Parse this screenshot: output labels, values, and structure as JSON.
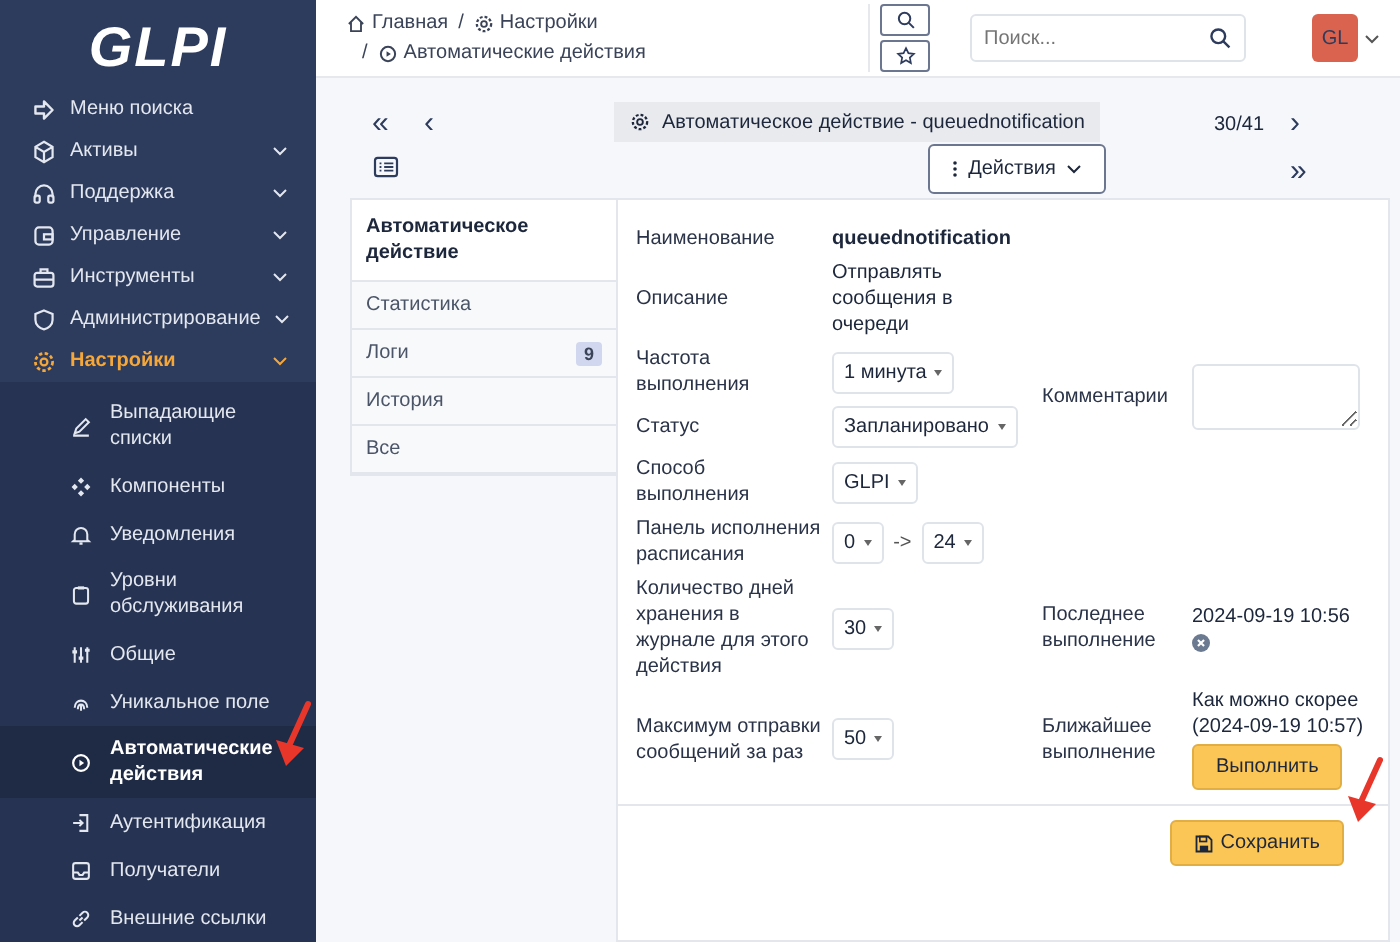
{
  "sidebar": {
    "logo": "GLPI",
    "items": [
      {
        "label": "Меню поиска",
        "has_caret": false,
        "selected": false
      },
      {
        "label": "Активы",
        "has_caret": true,
        "selected": false
      },
      {
        "label": "Поддержка",
        "has_caret": true,
        "selected": false
      },
      {
        "label": "Управление",
        "has_caret": true,
        "selected": false
      },
      {
        "label": "Инструменты",
        "has_caret": true,
        "selected": false
      },
      {
        "label": "Администрирование",
        "has_caret": true,
        "selected": false
      },
      {
        "label": "Настройки",
        "has_caret": true,
        "selected": true,
        "children": [
          {
            "label": "Выпадающие списки",
            "selected": false
          },
          {
            "label": "Компоненты",
            "selected": false
          },
          {
            "label": "Уведомления",
            "selected": false
          },
          {
            "label": "Уровни обслуживания",
            "selected": false
          },
          {
            "label": "Общие",
            "selected": false
          },
          {
            "label": "Уникальное поле",
            "selected": false
          },
          {
            "label": "Автоматические действия",
            "selected": true
          },
          {
            "label": "Аутентификация",
            "selected": false
          },
          {
            "label": "Получатели",
            "selected": false
          },
          {
            "label": "Внешние ссылки",
            "selected": false
          }
        ]
      }
    ]
  },
  "breadcrumb": {
    "separator": "/",
    "items": [
      "Главная",
      "Настройки",
      "Автоматические действия"
    ]
  },
  "search": {
    "placeholder": "Поиск..."
  },
  "user": {
    "initials": "GL",
    "color": "#d9634f"
  },
  "nav": {
    "first": "«",
    "previous": "‹",
    "title": "Автоматическое действие - queuednotification",
    "position": "30/41",
    "next": "›",
    "last": "»",
    "actions": "Действия"
  },
  "tabs": [
    {
      "label": "Автоматическое действие",
      "selected": true
    },
    {
      "label": "Статистика",
      "selected": false
    },
    {
      "label": "Логи",
      "badge": "9",
      "selected": false
    },
    {
      "label": "История",
      "selected": false
    },
    {
      "label": "Все",
      "selected": false
    }
  ],
  "form": {
    "name": {
      "label": "Наименование",
      "value": "queuednotification"
    },
    "description": {
      "label": "Описание",
      "value": "Отправлять сообщения в очереди"
    },
    "frequency": {
      "label": "Частота выполнения",
      "value": "1 минута"
    },
    "comments": {
      "label": "Комментарии"
    },
    "status": {
      "label": "Статус",
      "value": "Запланировано"
    },
    "mode": {
      "label": "Способ выполнения",
      "value": "GLPI"
    },
    "schedule": {
      "label": "Панель исполнения расписания",
      "from": "0",
      "separator": "->",
      "to": "24"
    },
    "log_days": {
      "label": "Количество дней хранения в журнале для этого действия",
      "value": "30"
    },
    "last_run": {
      "label": "Последнее выполнение",
      "value": "2024-09-19 10:56"
    },
    "max_send": {
      "label": "Максимум отправки сообщений за раз",
      "value": "50"
    },
    "next_run": {
      "label": "Ближайшее выполнение",
      "value": "Как можно скорее (2024-09-19 10:57)",
      "button": "Выполнить"
    },
    "save": "Сохранить"
  },
  "annotations": [
    {
      "kind": "arrow",
      "color": "#e8372a"
    },
    {
      "kind": "arrow",
      "color": "#e8372a"
    }
  ]
}
